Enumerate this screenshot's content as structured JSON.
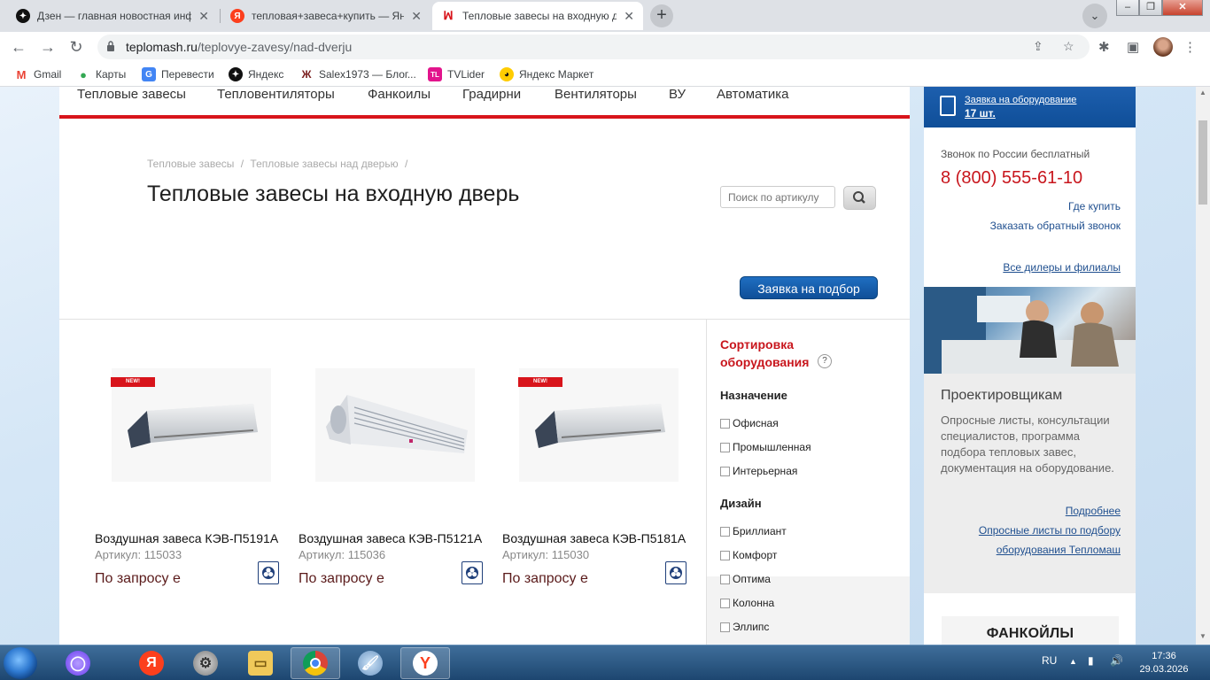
{
  "browser": {
    "tabs": [
      {
        "title": "Дзен — главная новостная инф",
        "active": false
      },
      {
        "title": "тепловая+завеса+купить — Янд",
        "active": false
      },
      {
        "title": "Тепловые завесы на входную д",
        "active": true
      }
    ],
    "address": {
      "domain": "teplomash.ru",
      "path": "/teplovye-zavesy/nad-dverju"
    },
    "bookmarks": [
      {
        "label": "Gmail"
      },
      {
        "label": "Карты"
      },
      {
        "label": "Перевести"
      },
      {
        "label": "Яндекс"
      },
      {
        "label": "Salex1973 — Блог..."
      },
      {
        "label": "TVLider"
      },
      {
        "label": "Яндекс Маркет"
      }
    ]
  },
  "nav": {
    "items": [
      "Тепловые завесы",
      "Тепловентиляторы",
      "Фанкоилы",
      "Градирни",
      "Вентиляторы",
      "ВУ",
      "Автоматика"
    ]
  },
  "breadcrumb": [
    "Тепловые завесы",
    "/",
    "Тепловые завесы над дверью",
    "/"
  ],
  "page": {
    "title": "Тепловые завесы на входную дверь",
    "search_placeholder": "Поиск по артикулу",
    "podbor_button": "Заявка на подбор"
  },
  "products": [
    {
      "name": "Воздушная завеса КЭВ-П5191А",
      "article": "Артикул: 115033",
      "price": "По запросу е",
      "new_badge": "NEW!"
    },
    {
      "name": "Воздушная завеса КЭВ-П5121А",
      "article": "Артикул: 115036",
      "price": "По запросу е",
      "new_badge": ""
    },
    {
      "name": "Воздушная завеса КЭВ-П5181А",
      "article": "Артикул: 115030",
      "price": "По запросу е",
      "new_badge": "NEW!"
    }
  ],
  "filter": {
    "title": "Сортировка оборудования",
    "help": "?",
    "groups": [
      {
        "label": "Назначение",
        "options": [
          "Офисная",
          "Промышленная",
          "Интерьерная"
        ]
      },
      {
        "label": "Дизайн",
        "options": [
          "Бриллиант",
          "Комфорт",
          "Оптима",
          "Колонна",
          "Эллипс"
        ]
      }
    ]
  },
  "sidebar": {
    "request_label": "Заявка на оборудование",
    "request_count": "17 шт.",
    "call_free": "Звонок по России бесплатный",
    "phone": "8 (800) 555-61-10",
    "where_buy": "Где купить",
    "callback": "Заказать обратный звонок",
    "dealers": "Все дилеры и филиалы",
    "projectors_title": "Проектировщикам",
    "projectors_text": "Опросные листы, консультации специалистов, программа подбора тепловых завес, документация на оборудование.",
    "more": "Подробнее",
    "survey_line1": "Опросные листы по подбору",
    "survey_line2": "оборудования Тепломаш",
    "banner": "ФАНКОЙЛЫ КАНАЛЬНЫЕ"
  },
  "taskbar": {
    "lang": "RU",
    "time": "17:36",
    "date": "29.03.2026"
  }
}
